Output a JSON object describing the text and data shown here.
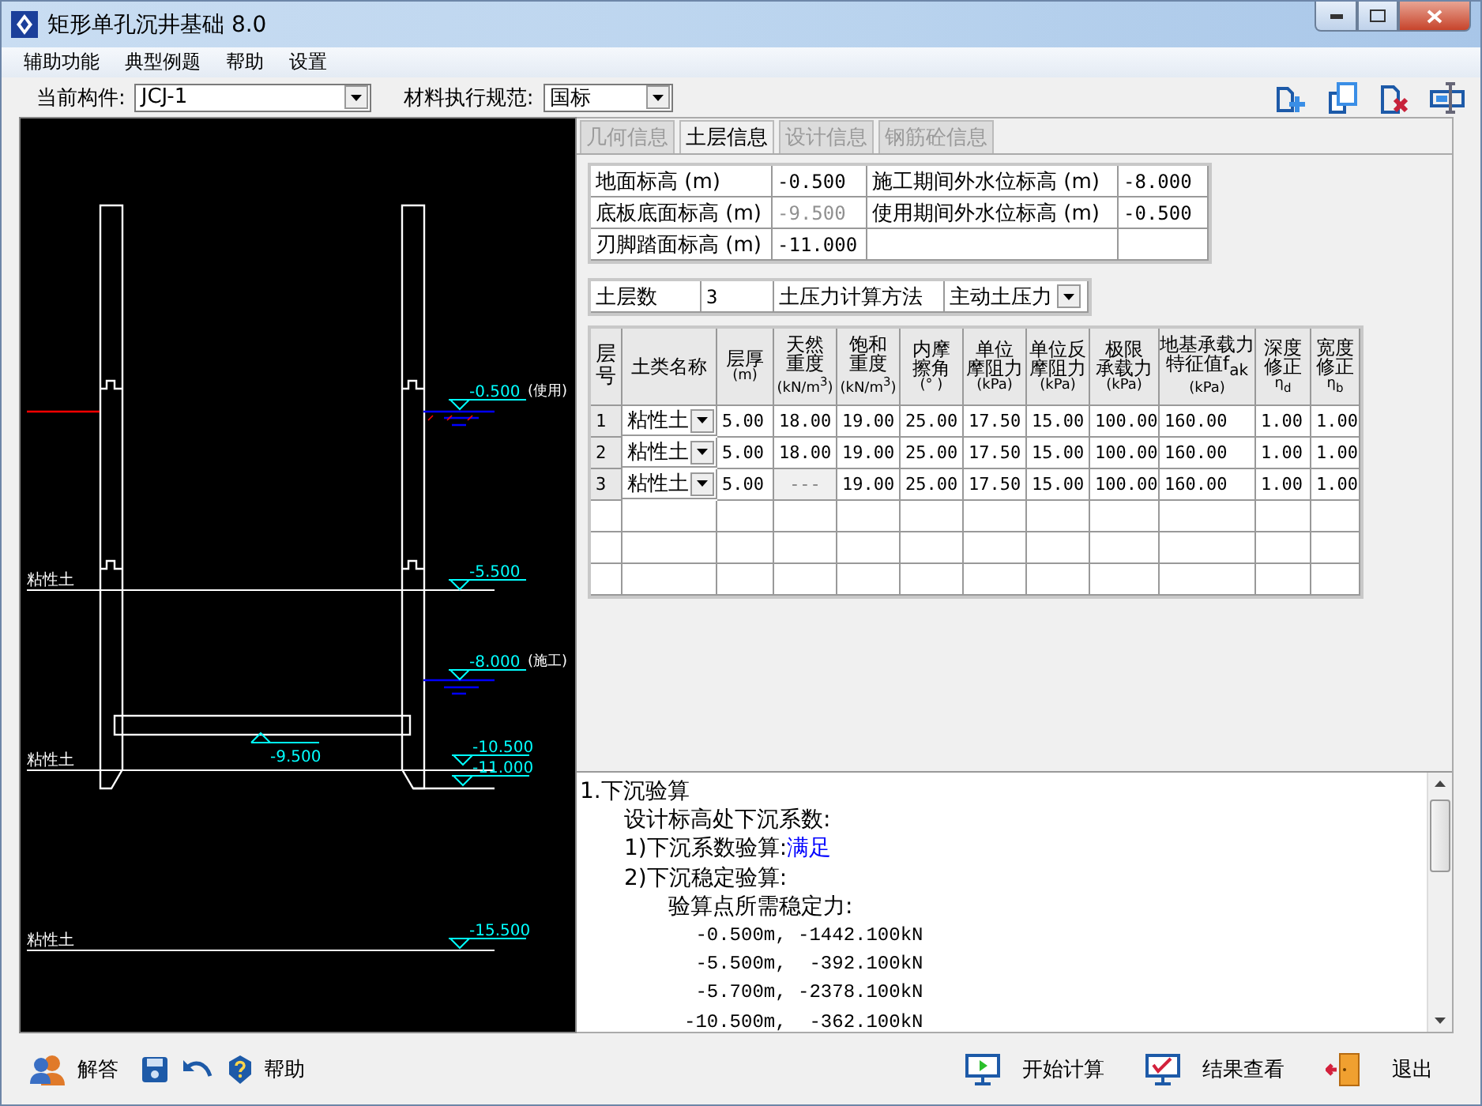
{
  "window": {
    "title": "矩形单孔沉井基础 8.0"
  },
  "menu": [
    "辅助功能",
    "典型例题",
    "帮助",
    "设置"
  ],
  "toolbar": {
    "fields": [
      {
        "label": "当前构件:",
        "value": "JCJ-1"
      },
      {
        "label": "材料执行规范:",
        "value": "国标"
      }
    ]
  },
  "drawing": {
    "elevations": [
      "-0.500",
      "-5.500",
      "-8.000",
      "-9.500",
      "-10.500",
      "-11.000",
      "-15.500"
    ],
    "water_notes": [
      "(使用)",
      "(施工)"
    ],
    "soil_labels": [
      "粘性土",
      "粘性土",
      "粘性土"
    ]
  },
  "tabs": [
    {
      "label": "几何信息",
      "selected": false
    },
    {
      "label": "土层信息",
      "selected": true
    },
    {
      "label": "设计信息",
      "selected": false
    },
    {
      "label": "钢筋砼信息",
      "selected": false
    }
  ],
  "params": [
    {
      "label": "地面标高 (m)",
      "value": "-0.500",
      "disabled": false
    },
    {
      "label": "施工期间外水位标高 (m)",
      "value": "-8.000",
      "disabled": false
    },
    {
      "label": "底板底面标高 (m)",
      "value": "-9.500",
      "disabled": true
    },
    {
      "label": "使用期间外水位标高 (m)",
      "value": "-0.500",
      "disabled": false
    },
    {
      "label": "刃脚踏面标高 (m)",
      "value": "-11.000",
      "disabled": false
    }
  ],
  "soil_settings": {
    "count_label": "土层数",
    "count": "3",
    "method_label": "土压力计算方法",
    "method": "主动土压力"
  },
  "table": {
    "columns": [
      {
        "lines": [
          "层号"
        ],
        "kind": "vertical"
      },
      {
        "lines": [
          "土类名称"
        ],
        "kind": "plain"
      },
      {
        "lines": [
          "层厚",
          "(m)"
        ],
        "kind": "plain"
      },
      {
        "lines": [
          "天然",
          "重度",
          "(kN/m$^{3}$)"
        ],
        "kind": "plain"
      },
      {
        "lines": [
          "饱和",
          "重度",
          "(kN/m$^{3}$)"
        ],
        "kind": "plain"
      },
      {
        "lines": [
          "内摩",
          "擦角",
          "(° )"
        ],
        "kind": "plain"
      },
      {
        "lines": [
          "单位",
          "摩阻力",
          "(kPa)"
        ],
        "kind": "plain"
      },
      {
        "lines": [
          "单位反",
          "摩阻力",
          "(kPa)"
        ],
        "kind": "plain"
      },
      {
        "lines": [
          "极限",
          "承载力",
          "(kPa)"
        ],
        "kind": "plain"
      },
      {
        "lines": [
          "地基承载力",
          "特征值f$_{ak}$",
          "(kPa)"
        ],
        "kind": "plain"
      },
      {
        "lines": [
          "深度",
          "修正",
          "η$_{d}$"
        ],
        "kind": "plain"
      },
      {
        "lines": [
          "宽度",
          "修正",
          "η$_{b}$"
        ],
        "kind": "plain"
      }
    ],
    "rows": [
      {
        "cells": [
          {
            "value": "1",
            "kind": "index",
            "disabled": false
          },
          {
            "value": "粘性土",
            "kind": "select",
            "disabled": false
          },
          {
            "value": "5.00",
            "kind": "number",
            "disabled": false
          },
          {
            "value": "18.00",
            "kind": "number",
            "disabled": false
          },
          {
            "value": "19.00",
            "kind": "number",
            "disabled": false
          },
          {
            "value": "25.00",
            "kind": "number",
            "disabled": false
          },
          {
            "value": "17.50",
            "kind": "number",
            "disabled": false
          },
          {
            "value": "15.00",
            "kind": "number",
            "disabled": false
          },
          {
            "value": "100.00",
            "kind": "number",
            "disabled": false
          },
          {
            "value": "160.00",
            "kind": "number",
            "disabled": false
          },
          {
            "value": "1.00",
            "kind": "number",
            "disabled": false
          },
          {
            "value": "1.00",
            "kind": "number",
            "disabled": false
          }
        ]
      },
      {
        "cells": [
          {
            "value": "2",
            "kind": "index",
            "disabled": false
          },
          {
            "value": "粘性土",
            "kind": "select",
            "disabled": false
          },
          {
            "value": "5.00",
            "kind": "number",
            "disabled": false
          },
          {
            "value": "18.00",
            "kind": "number",
            "disabled": false
          },
          {
            "value": "19.00",
            "kind": "number",
            "disabled": false
          },
          {
            "value": "25.00",
            "kind": "number",
            "disabled": false
          },
          {
            "value": "17.50",
            "kind": "number",
            "disabled": false
          },
          {
            "value": "15.00",
            "kind": "number",
            "disabled": false
          },
          {
            "value": "100.00",
            "kind": "number",
            "disabled": false
          },
          {
            "value": "160.00",
            "kind": "number",
            "disabled": false
          },
          {
            "value": "1.00",
            "kind": "number",
            "disabled": false
          },
          {
            "value": "1.00",
            "kind": "number",
            "disabled": false
          }
        ]
      },
      {
        "cells": [
          {
            "value": "3",
            "kind": "index",
            "disabled": false
          },
          {
            "value": "粘性土",
            "kind": "select",
            "disabled": false
          },
          {
            "value": "5.00",
            "kind": "number",
            "disabled": false
          },
          {
            "value": "---",
            "kind": "number",
            "disabled": true
          },
          {
            "value": "19.00",
            "kind": "number",
            "disabled": false
          },
          {
            "value": "25.00",
            "kind": "number",
            "disabled": false
          },
          {
            "value": "17.50",
            "kind": "number",
            "disabled": false
          },
          {
            "value": "15.00",
            "kind": "number",
            "disabled": false
          },
          {
            "value": "100.00",
            "kind": "number",
            "disabled": false
          },
          {
            "value": "160.00",
            "kind": "number",
            "disabled": false
          },
          {
            "value": "1.00",
            "kind": "number",
            "disabled": false
          },
          {
            "value": "1.00",
            "kind": "number",
            "disabled": false
          }
        ]
      }
    ]
  },
  "results": [
    {
      "text": "1.下沉验算",
      "kind": "text",
      "children": [
        {
          "text": "设计标高处下沉系数:",
          "kind": "text"
        },
        {
          "text": "1)下沉系数验算:",
          "result": "满足",
          "kind": "text"
        },
        {
          "text": "2)下沉稳定验算:",
          "kind": "text",
          "children": [
            {
              "text": "验算点所需稳定力:",
              "kind": "text",
              "children": [
                {
                  "text": " -0.500m, -1442.100kN",
                  "kind": "mono"
                },
                {
                  "text": " -5.500m,  -392.100kN",
                  "kind": "mono"
                },
                {
                  "text": " -5.700m, -2378.100kN",
                  "kind": "mono"
                },
                {
                  "text": "-10.500m,  -362.100kN",
                  "kind": "mono"
                }
              ]
            }
          ]
        }
      ]
    }
  ],
  "bottom_left": [
    {
      "label": "解答",
      "kind": "people"
    },
    {
      "kind": "save"
    },
    {
      "kind": "undo"
    },
    {
      "label": "帮助",
      "kind": "help"
    }
  ],
  "bottom_right": [
    {
      "label": "开始计算",
      "kind": "start"
    },
    {
      "label": "结果查看",
      "kind": "check"
    },
    {
      "label": "退出",
      "kind": "exit"
    }
  ]
}
